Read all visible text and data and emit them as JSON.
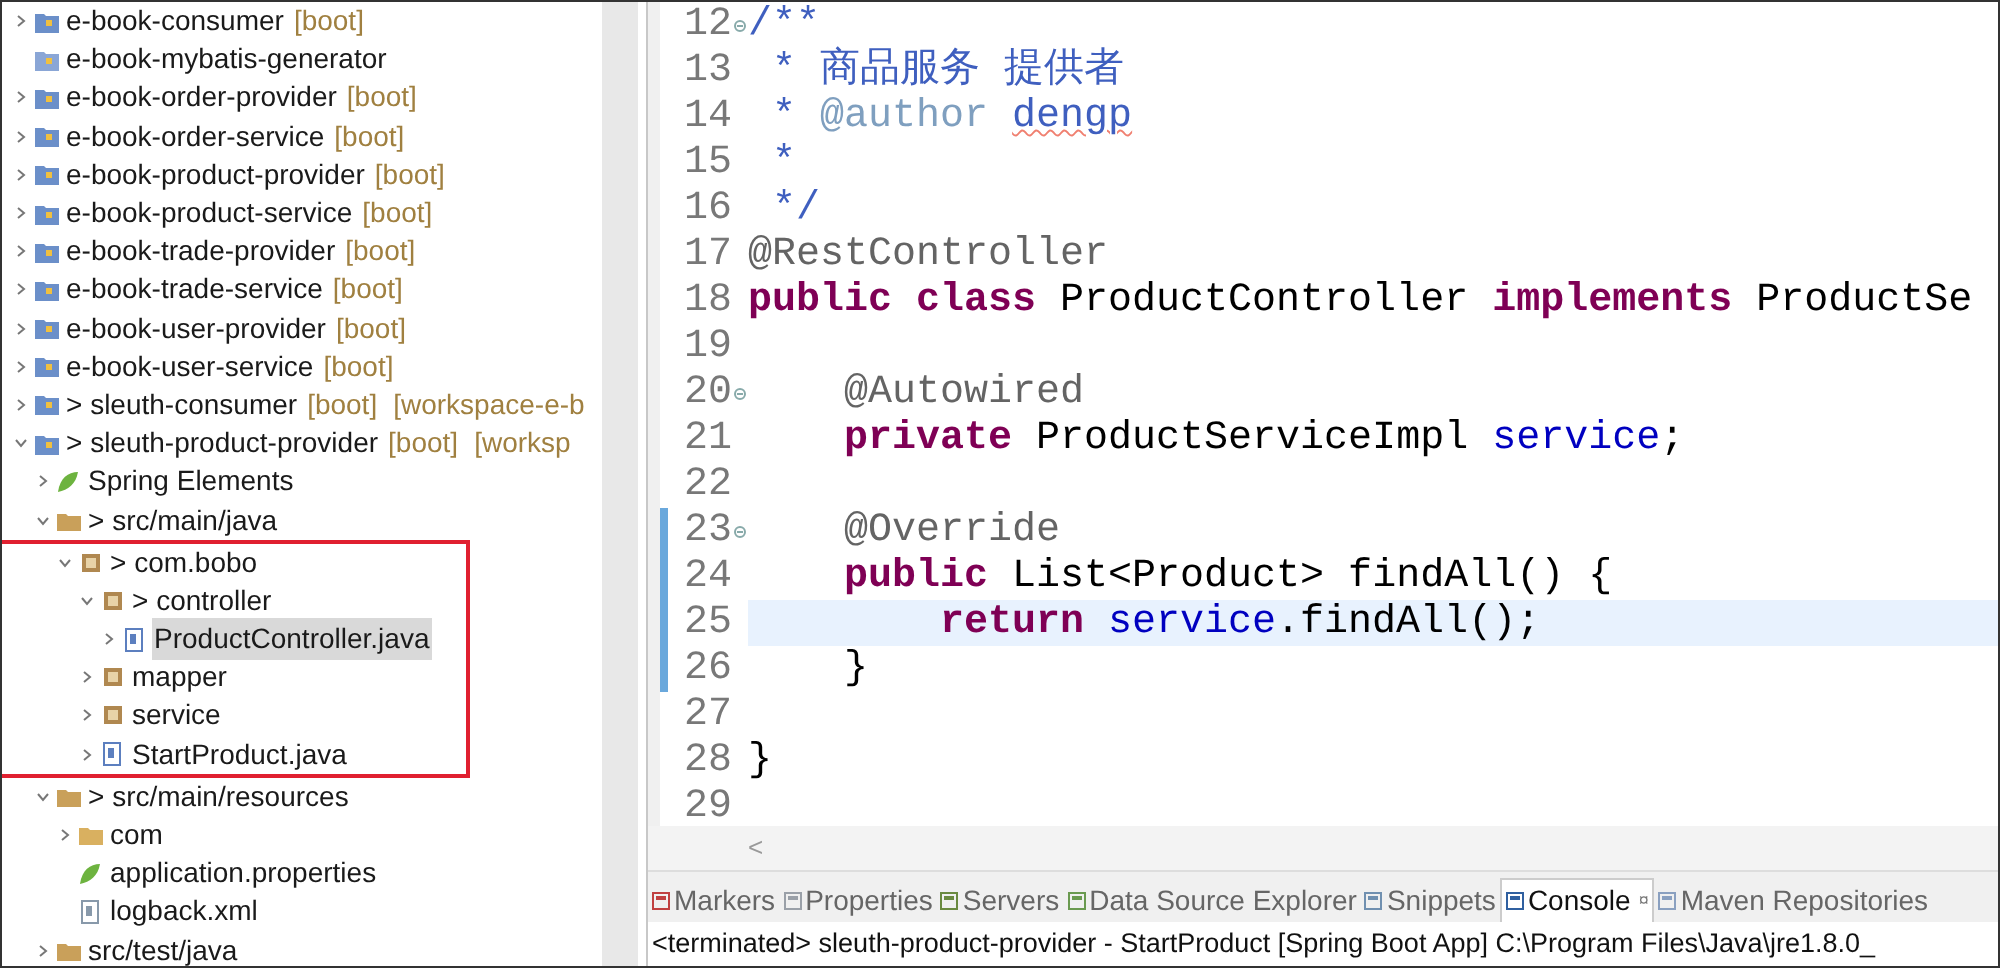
{
  "explorer": {
    "items": [
      {
        "label": "e-book-consumer",
        "decoration": "[boot]",
        "kind": "project",
        "expanded": false,
        "selected": false
      },
      {
        "label": "e-book-mybatis-generator",
        "kind": "plain-project",
        "selected": false
      },
      {
        "label": "e-book-order-provider",
        "decoration": "[boot]",
        "kind": "project",
        "expanded": false,
        "selected": false
      },
      {
        "label": "e-book-order-service",
        "decoration": "[boot]",
        "kind": "project",
        "expanded": false,
        "selected": false
      },
      {
        "label": "e-book-product-provider",
        "decoration": "[boot]",
        "kind": "project",
        "expanded": false,
        "selected": false
      },
      {
        "label": "e-book-product-service",
        "decoration": "[boot]",
        "kind": "project",
        "expanded": false,
        "selected": false
      },
      {
        "label": "e-book-trade-provider",
        "decoration": "[boot]",
        "kind": "project",
        "expanded": false,
        "selected": false
      },
      {
        "label": "e-book-trade-service",
        "decoration": "[boot]",
        "kind": "project",
        "expanded": false,
        "selected": false
      },
      {
        "label": "e-book-user-provider",
        "decoration": "[boot]",
        "kind": "project",
        "expanded": false,
        "selected": false
      },
      {
        "label": "e-book-user-service",
        "decoration": "[boot]",
        "kind": "project",
        "expanded": false,
        "selected": false
      },
      {
        "label": "sleuth-consumer",
        "prefix": ">",
        "decoration": "[boot]",
        "workspace": "[workspace-e-b",
        "kind": "project",
        "expanded": false,
        "selected": false
      },
      {
        "label": "sleuth-product-provider",
        "prefix": ">",
        "decoration": "[boot]",
        "workspace": "[worksp",
        "kind": "project",
        "expanded": true,
        "selected": false,
        "children": [
          {
            "label": "Spring Elements",
            "kind": "spring",
            "expanded": false,
            "selected": false
          },
          {
            "label": "src/main/java",
            "prefix": ">",
            "kind": "source-folder",
            "expanded": true,
            "selected": false,
            "children": [
              {
                "label": "com.bobo",
                "prefix": ">",
                "kind": "package",
                "expanded": true,
                "selected": false,
                "outlined": true,
                "children": [
                  {
                    "label": "controller",
                    "prefix": ">",
                    "kind": "package",
                    "expanded": true,
                    "selected": false,
                    "children": [
                      {
                        "label": "ProductController.java",
                        "kind": "java",
                        "expanded": false,
                        "selected": true
                      }
                    ]
                  },
                  {
                    "label": "mapper",
                    "kind": "package",
                    "expanded": false,
                    "selected": false
                  },
                  {
                    "label": "service",
                    "kind": "package",
                    "expanded": false,
                    "selected": false
                  },
                  {
                    "label": "StartProduct.java",
                    "kind": "java",
                    "expanded": false,
                    "selected": false
                  }
                ]
              }
            ]
          },
          {
            "label": "src/main/resources",
            "prefix": ">",
            "kind": "source-folder",
            "expanded": true,
            "selected": false,
            "children": [
              {
                "label": "com",
                "kind": "folder",
                "expanded": false,
                "selected": false
              },
              {
                "label": "application.properties",
                "kind": "spring",
                "selected": false
              },
              {
                "label": "logback.xml",
                "kind": "file",
                "selected": false
              }
            ]
          },
          {
            "label": "src/test/java",
            "kind": "source-folder",
            "expanded": false,
            "selected": false
          }
        ]
      }
    ]
  },
  "editor": {
    "lines": [
      {
        "number": "12",
        "fold": true,
        "changed": false,
        "current": false,
        "tokens": [
          {
            "kind": "javadoc",
            "text": "/**"
          }
        ]
      },
      {
        "number": "13",
        "fold": false,
        "changed": false,
        "current": false,
        "tokens": [
          {
            "kind": "javadoc",
            "text": " * 商品服务 提供者"
          }
        ]
      },
      {
        "number": "14",
        "fold": false,
        "changed": false,
        "current": false,
        "tokens": [
          {
            "kind": "javadoc",
            "text": " *"
          },
          {
            "kind": "javadoc-tag",
            "text": " @author"
          },
          {
            "kind": "misspelled",
            "text": " dengp"
          }
        ]
      },
      {
        "number": "15",
        "fold": false,
        "changed": false,
        "current": false,
        "tokens": [
          {
            "kind": "javadoc",
            "text": " *"
          }
        ]
      },
      {
        "number": "16",
        "fold": false,
        "changed": false,
        "current": false,
        "tokens": [
          {
            "kind": "javadoc",
            "text": " */"
          }
        ]
      },
      {
        "number": "17",
        "fold": false,
        "changed": false,
        "current": false,
        "tokens": [
          {
            "kind": "annotation",
            "text": "@RestController"
          }
        ]
      },
      {
        "number": "18",
        "fold": false,
        "changed": false,
        "current": false,
        "tokens": [
          {
            "kind": "keyword",
            "text": "public class"
          },
          {
            "kind": "plain",
            "text": " ProductController "
          },
          {
            "kind": "keyword",
            "text": "implements"
          },
          {
            "kind": "plain",
            "text": " ProductSe"
          }
        ]
      },
      {
        "number": "19",
        "fold": false,
        "changed": false,
        "current": false
      },
      {
        "number": "20",
        "fold": true,
        "changed": false,
        "current": false,
        "tokens": [
          {
            "kind": "annotation",
            "text": "    @Autowired"
          }
        ]
      },
      {
        "number": "21",
        "fold": false,
        "changed": false,
        "current": false,
        "tokens": [
          {
            "kind": "keyword",
            "text": "    private"
          },
          {
            "kind": "plain",
            "text": " ProductServiceImpl"
          },
          {
            "kind": "field",
            "text": " service"
          },
          {
            "kind": "plain",
            "text": ";"
          }
        ]
      },
      {
        "number": "22",
        "fold": false,
        "changed": false,
        "current": false
      },
      {
        "number": "23",
        "fold": true,
        "changed": true,
        "current": false,
        "tokens": [
          {
            "kind": "annotation",
            "text": "    @Override"
          }
        ]
      },
      {
        "number": "24",
        "fold": false,
        "changed": true,
        "current": false,
        "tokens": [
          {
            "kind": "keyword",
            "text": "    public"
          },
          {
            "kind": "plain",
            "text": " List<Product> findAll() {"
          }
        ]
      },
      {
        "number": "25",
        "fold": false,
        "changed": true,
        "current": true,
        "tokens": [
          {
            "kind": "keyword",
            "text": "        return"
          },
          {
            "kind": "field",
            "text": " service"
          },
          {
            "kind": "plain",
            "text": ".findAll();"
          }
        ]
      },
      {
        "number": "26",
        "fold": false,
        "changed": true,
        "current": false,
        "tokens": [
          {
            "kind": "plain",
            "text": "    }"
          }
        ]
      },
      {
        "number": "27",
        "fold": false,
        "changed": false,
        "current": false
      },
      {
        "number": "28",
        "fold": false,
        "changed": false,
        "current": false,
        "tokens": [
          {
            "kind": "plain",
            "text": "}"
          }
        ]
      },
      {
        "number": "29",
        "fold": false,
        "changed": false,
        "current": false
      }
    ],
    "scroll_arrow": "<"
  },
  "bottom_panel": {
    "tabs": [
      {
        "label": "Markers",
        "kind": "markers",
        "selected": false
      },
      {
        "label": "Properties",
        "kind": "properties",
        "selected": false
      },
      {
        "label": "Servers",
        "kind": "servers",
        "selected": false
      },
      {
        "label": "Data Source Explorer",
        "kind": "datasource",
        "selected": false
      },
      {
        "label": "Snippets",
        "kind": "snippets",
        "selected": false
      },
      {
        "label": "Console",
        "kind": "console",
        "selected": true,
        "close": "¤"
      },
      {
        "label": "Maven Repositories",
        "kind": "maven",
        "selected": false
      }
    ],
    "console_text": "<terminated> sleuth-product-provider - StartProduct [Spring Boot App] C:\\Program Files\\Java\\jre1.8.0_"
  }
}
